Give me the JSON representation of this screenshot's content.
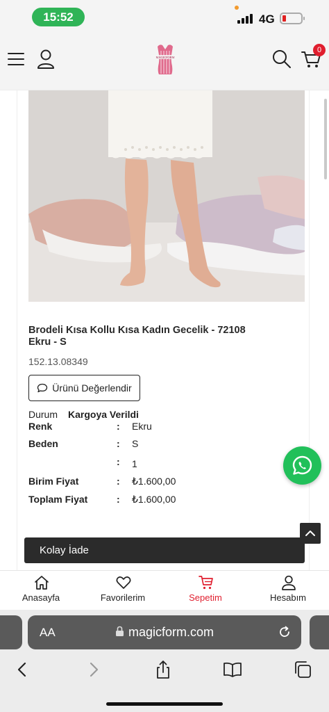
{
  "status_bar": {
    "time": "15:52",
    "network": "4G"
  },
  "header": {
    "logo_text": "MAGICFORM",
    "cart_count": "0"
  },
  "product": {
    "title": "Brodeli Kısa Kollu Kısa Kadın Gecelik - 72108 Ekru - S",
    "code": "152.13.08349",
    "review_button": "Ürünü Değerlendir",
    "status_label": "Durum",
    "status_value": "Kargoya Verildi",
    "details": [
      {
        "label": "Renk",
        "value": "Ekru"
      },
      {
        "label": "Beden",
        "value": "S"
      },
      {
        "label": "",
        "value": "1"
      },
      {
        "label": "Birim Fiyat",
        "value": "₺1.600,00"
      },
      {
        "label": "Toplam Fiyat",
        "value": "₺1.600,00"
      }
    ],
    "separator": ":"
  },
  "return_bar": {
    "label": "Kolay İade"
  },
  "bottom_nav": {
    "items": [
      {
        "label": "Anasayfa",
        "icon": "home-icon"
      },
      {
        "label": "Favorilerim",
        "icon": "heart-icon"
      },
      {
        "label": "Sepetim",
        "icon": "cart-icon",
        "active": true
      },
      {
        "label": "Hesabım",
        "icon": "user-icon"
      }
    ],
    "active_color": "#e01e2e"
  },
  "browser": {
    "text_size_label": "AA",
    "url": "magicform.com"
  },
  "colors": {
    "accent": "#e01e2e",
    "whatsapp": "#21c05a",
    "status_pill": "#2fb457"
  }
}
